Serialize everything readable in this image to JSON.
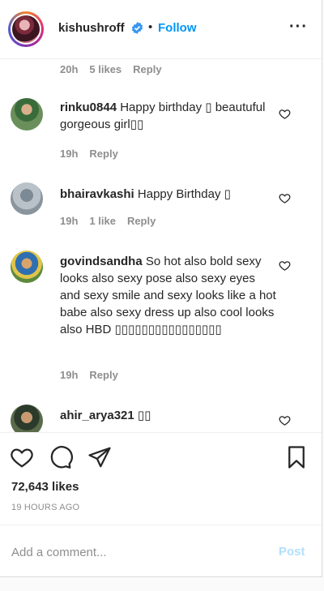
{
  "header": {
    "username": "kishushroff",
    "separator": "•",
    "follow_label": "Follow",
    "more_label": "···",
    "avatar_icon": "profile-avatar"
  },
  "top_meta": {
    "time": "20h",
    "likes": "5 likes",
    "reply": "Reply"
  },
  "comments": [
    {
      "user": "rinku0844",
      "text": "Happy birthday ▯ beautuful gorgeous girl▯▯",
      "time": "19h",
      "likes": "",
      "reply": "Reply"
    },
    {
      "user": "bhairavkashi",
      "text": "Happy Birthday ▯",
      "time": "19h",
      "likes": "1 like",
      "reply": "Reply"
    },
    {
      "user": "govindsandha",
      "text": "So hot also bold sexy looks also sexy pose also sexy eyes and sexy smile and sexy looks like a hot babe also sexy dress up also cool looks also HBD ▯▯▯▯▯▯▯▯▯▯▯▯▯▯▯▯",
      "time": "19h",
      "likes": "",
      "reply": "Reply"
    },
    {
      "user": "ahir_arya321",
      "text": "▯▯"
    }
  ],
  "post": {
    "likes": "72,643 likes",
    "time": "19 HOURS AGO"
  },
  "add_comment": {
    "placeholder": "Add a comment...",
    "post_label": "Post"
  },
  "colors": {
    "link_blue": "#0095f6",
    "post_disabled": "#b2dffc",
    "secondary_text": "#8e8e8e"
  }
}
